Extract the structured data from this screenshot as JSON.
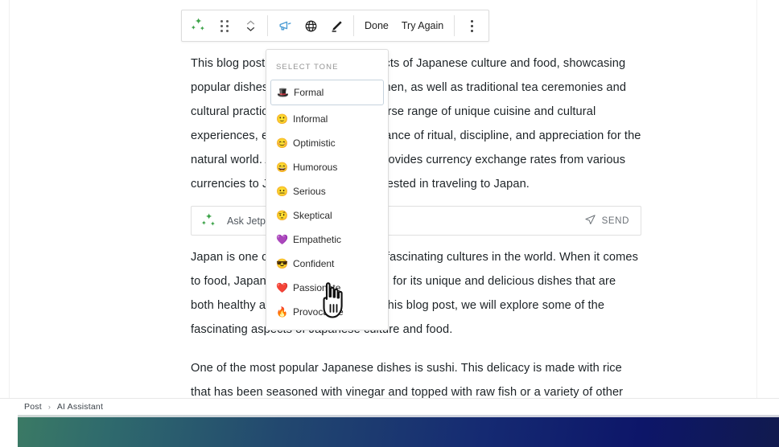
{
  "toolbar": {
    "jetpack_icon": "sparkle-icon",
    "drag_handle_icon": "drag-handle-icon",
    "move_updown_icon": "move-up-down-icon",
    "tone_icon": "megaphone-tone-icon",
    "translate_icon": "globe-translate-icon",
    "improve_icon": "pencil-improve-icon",
    "done_label": "Done",
    "try_again_label": "Try Again",
    "more_icon": "more-options-icon"
  },
  "article": {
    "paragraphs": [
      "This blog post explores various aspects of Japanese culture and food, showcasing popular dishes such as sushi and ramen, as well as traditional tea ceremonies and cultural practices. Japan offers a diverse range of unique cuisine and cultural experiences, emphasizing the importance of ritual, discipline, and appreciation for the natural world. Additionally, the blog provides currency exchange rates from various currencies to JPY for individuals interested in traveling to Japan.",
      "Japan is one of the most unique and fascinating cultures in the world. When it comes to food, Japan is especially renowned for its unique and delicious dishes that are both healthy and mouth-watering. In this blog post, we will explore some of the fascinating aspects of Japanese culture and food.",
      "One of the most popular Japanese dishes is sushi. This delicacy is made with rice that has been seasoned with vinegar and topped with raw fish or a variety of other ingredients. Sushi is known for its unique flavors and textures, and it represents an"
    ]
  },
  "ask_bar": {
    "icon": "sparkle-icon",
    "placeholder": "Ask Jetpack AI",
    "value": "",
    "send_label": "SEND",
    "send_icon": "paper-plane-icon"
  },
  "tone_menu": {
    "header": "SELECT TONE",
    "selected": "Formal",
    "items": [
      {
        "emoji": "🎩",
        "label": "Formal"
      },
      {
        "emoji": "🙂",
        "label": "Informal"
      },
      {
        "emoji": "😊",
        "label": "Optimistic"
      },
      {
        "emoji": "😄",
        "label": "Humorous"
      },
      {
        "emoji": "😐",
        "label": "Serious"
      },
      {
        "emoji": "🤨",
        "label": "Skeptical"
      },
      {
        "emoji": "💜",
        "label": "Empathetic"
      },
      {
        "emoji": "😎",
        "label": "Confident"
      },
      {
        "emoji": "❤️",
        "label": "Passionate"
      },
      {
        "emoji": "🔥",
        "label": "Provocative"
      }
    ]
  },
  "breadcrumb": {
    "items": [
      "Post",
      "AI Assistant"
    ],
    "separator": "›"
  },
  "colors": {
    "accent_green": "#3ea34a",
    "tone_active": "#4a9bd4",
    "text": "#1d2327",
    "muted": "#949494",
    "strip_start": "#3d7d63",
    "strip_end": "#111a4e"
  }
}
